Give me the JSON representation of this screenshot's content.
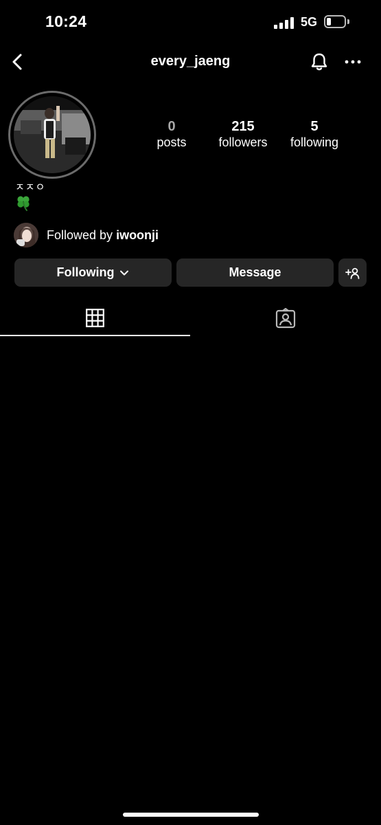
{
  "status_bar": {
    "time": "10:24",
    "network": "5G",
    "signal_bars": 4,
    "battery_level": 0.25
  },
  "header": {
    "username": "every_jaeng",
    "icons": [
      "back-arrow-icon",
      "bell-icon",
      "more-icon"
    ]
  },
  "profile": {
    "stats": [
      {
        "value": "0",
        "label": "posts"
      },
      {
        "value": "215",
        "label": "followers"
      },
      {
        "value": "5",
        "label": "following"
      }
    ],
    "bio_name": "ㅈㅈㅇ",
    "bio_emoji": "four-leaf-clover",
    "followed_by_prefix": "Followed by ",
    "followed_by_user": "iwoonji"
  },
  "actions": {
    "following_label": "Following",
    "message_label": "Message",
    "add_user_icon": "add-person-icon"
  },
  "tabs": [
    {
      "name": "grid",
      "icon": "grid-icon",
      "active": true
    },
    {
      "name": "tagged",
      "icon": "tagged-person-icon",
      "active": false
    }
  ],
  "colors": {
    "background": "#000000",
    "button_bg": "#262626",
    "text": "#ffffff",
    "muted": "#a8a8a8"
  }
}
